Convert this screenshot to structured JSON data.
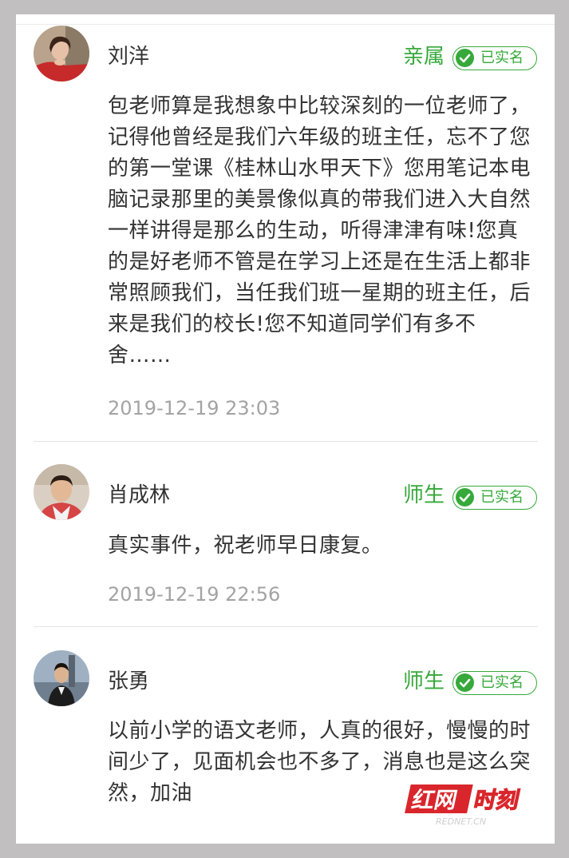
{
  "verified_label": "已实名",
  "colors": {
    "accent": "#36a93a",
    "text": "#333333",
    "timestamp": "#a3a3a3"
  },
  "comments": [
    {
      "name": "刘洋",
      "relation": "亲属",
      "text": "包老师算是我想象中比较深刻的一位老师了，记得他曾经是我们六年级的班主任，忘不了您的第一堂课《桂林山水甲天下》您用笔记本电脑记录那里的美景像似真的带我们进入大自然一样讲得是那么的生动，听得津津有味!您真的是好老师不管是在学习上还是在生活上都非常照顾我们，当任我们班一星期的班主任，后来是我们的校长!您不知道同学们有多不舍……",
      "timestamp": "2019-12-19 23:03",
      "verified_icon": "check-circle-icon"
    },
    {
      "name": "肖成林",
      "relation": "师生",
      "text": "真实事件，祝老师早日康复。",
      "timestamp": "2019-12-19 22:56",
      "verified_icon": "check-circle-icon"
    },
    {
      "name": "张勇",
      "relation": "师生",
      "text": "以前小学的语文老师，人真的很好，慢慢的时间少了，见面机会也不多了，消息也是这么突然，加油",
      "verified_icon": "check-circle-icon"
    }
  ],
  "watermark": {
    "main": "红网时刻",
    "sub": "REDNET.CN"
  }
}
